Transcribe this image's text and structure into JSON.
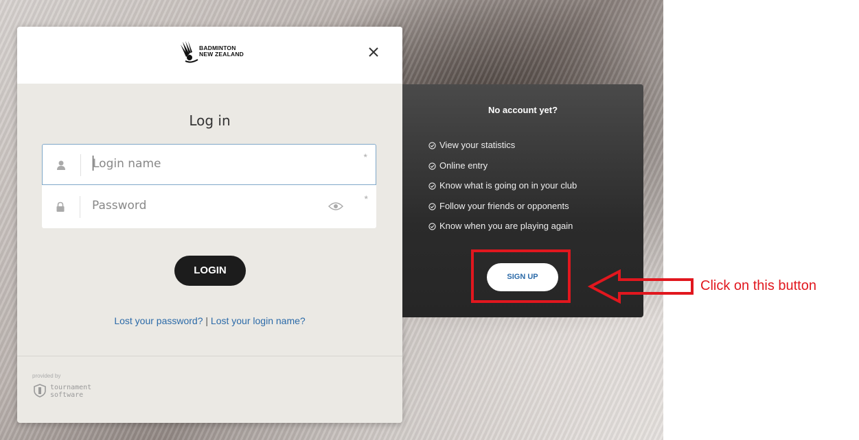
{
  "brand": {
    "name_line1": "BADMINTON",
    "name_line2": "NEW ZEALAND"
  },
  "login": {
    "title": "Log in",
    "login_placeholder": "Login name",
    "password_placeholder": "Password",
    "required_mark": "*",
    "login_button": "LOGIN",
    "lost_password": "Lost your password?",
    "separator": "|",
    "lost_login_name": "Lost your login name?"
  },
  "footer": {
    "provided_by": "provided by",
    "provider_line1": "tournament",
    "provider_line2": "software"
  },
  "signup": {
    "title": "No account yet?",
    "benefits": [
      "View your statistics",
      "Online entry",
      "Know what is going on in your club",
      "Follow your friends or opponents",
      "Know when you are playing again"
    ],
    "button": "SIGN UP"
  },
  "annotation": {
    "text": "Click on this button",
    "color": "#e1171e"
  },
  "colors": {
    "link": "#2b6aa8",
    "login_button_bg": "#1c1c1c",
    "panel_bg": "#2b2b2b",
    "card_bg": "#ebe9e4"
  },
  "icons": {
    "close": "close-icon",
    "user": "user-icon",
    "lock": "lock-icon",
    "eye": "eye-icon",
    "check": "check-circle-icon"
  }
}
